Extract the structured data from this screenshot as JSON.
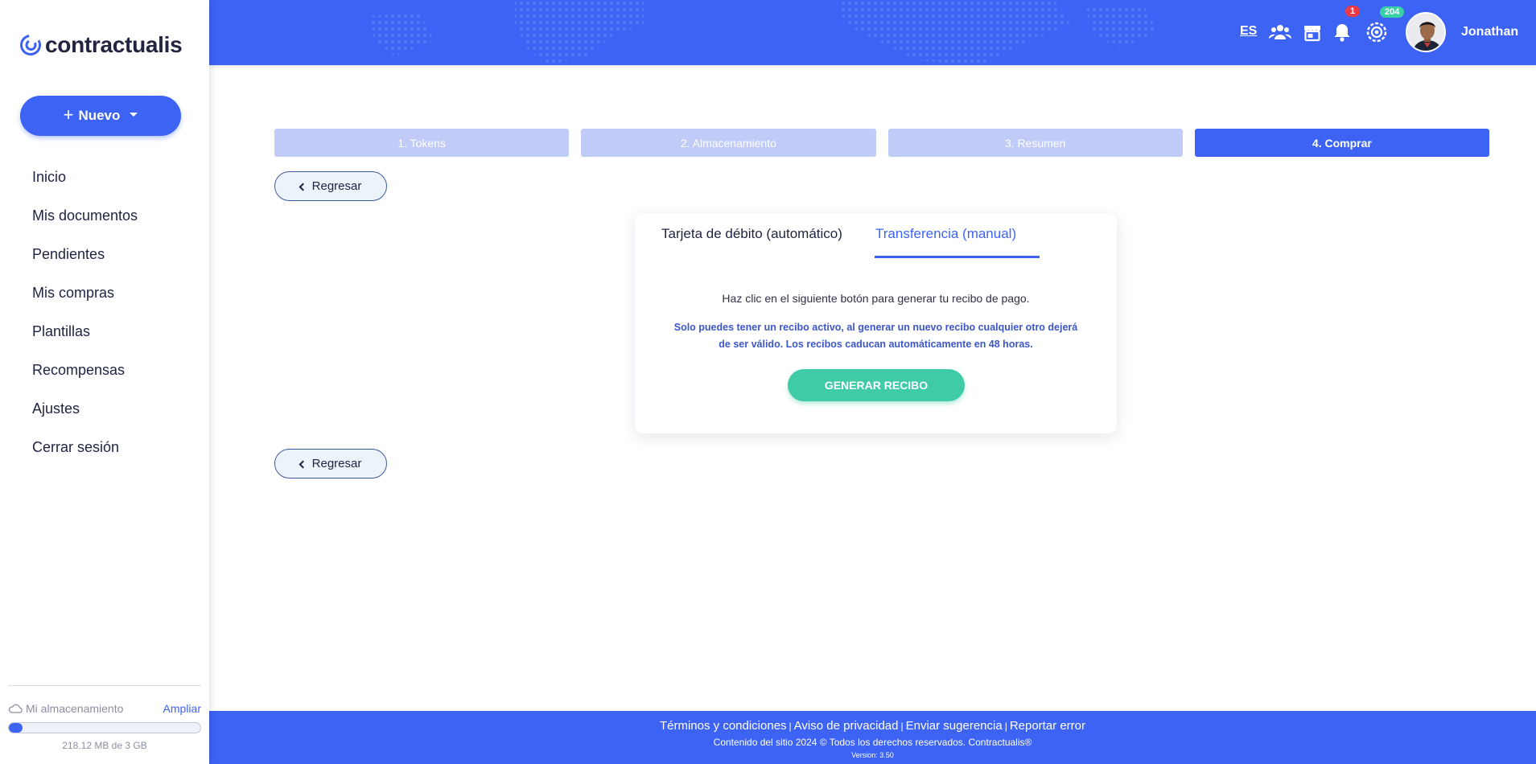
{
  "app": {
    "name": "contractualis"
  },
  "sidebar": {
    "new_button": "Nuevo",
    "items": [
      {
        "label": "Inicio"
      },
      {
        "label": "Mis documentos"
      },
      {
        "label": "Pendientes"
      },
      {
        "label": "Mis compras"
      },
      {
        "label": "Plantillas"
      },
      {
        "label": "Recompensas"
      },
      {
        "label": "Ajustes"
      },
      {
        "label": "Cerrar sesión"
      }
    ],
    "storage": {
      "label": "Mi almacenamiento",
      "link": "Ampliar",
      "usage_text": "218.12 MB de 3 GB",
      "used_fraction": 0.071
    }
  },
  "header": {
    "language": "ES",
    "notifications_count": "1",
    "rewards_count": "204",
    "username": "Jonathan",
    "icons": [
      "users-icon",
      "store-icon",
      "bell-icon",
      "rewards-icon"
    ]
  },
  "steps": [
    {
      "label": "1. Tokens",
      "active": false
    },
    {
      "label": "2. Almacenamiento",
      "active": false
    },
    {
      "label": "3. Resumen",
      "active": false
    },
    {
      "label": "4. Comprar",
      "active": true
    }
  ],
  "back_button": "Regresar",
  "payment": {
    "tabs": [
      {
        "label": "Tarjeta de débito (automático)"
      },
      {
        "label": "Transferencia (manual)",
        "active": true
      }
    ],
    "message": "Haz clic en el siguiente botón para generar tu recibo de pago.",
    "note": "Solo puedes tener un recibo activo, al generar un nuevo recibo cualquier otro dejerá de ser válido. Los recibos caducan automáticamente en 48 horas.",
    "generate_button": "GENERAR RECIBO"
  },
  "footer": {
    "links": [
      "Términos y condiciones",
      "Aviso de privacidad",
      "Enviar sugerencia",
      "Reportar error"
    ],
    "copyright": "Contenido del sitio 2024 © Todos los derechos reservados. Contractualis®",
    "version": "Version: 3.50"
  },
  "colors": {
    "primary": "#3d63f5",
    "step_inactive": "#c1cbf8",
    "success": "#3ecba5",
    "badge_red": "#ea3a47",
    "badge_green": "#3ad0a6"
  }
}
